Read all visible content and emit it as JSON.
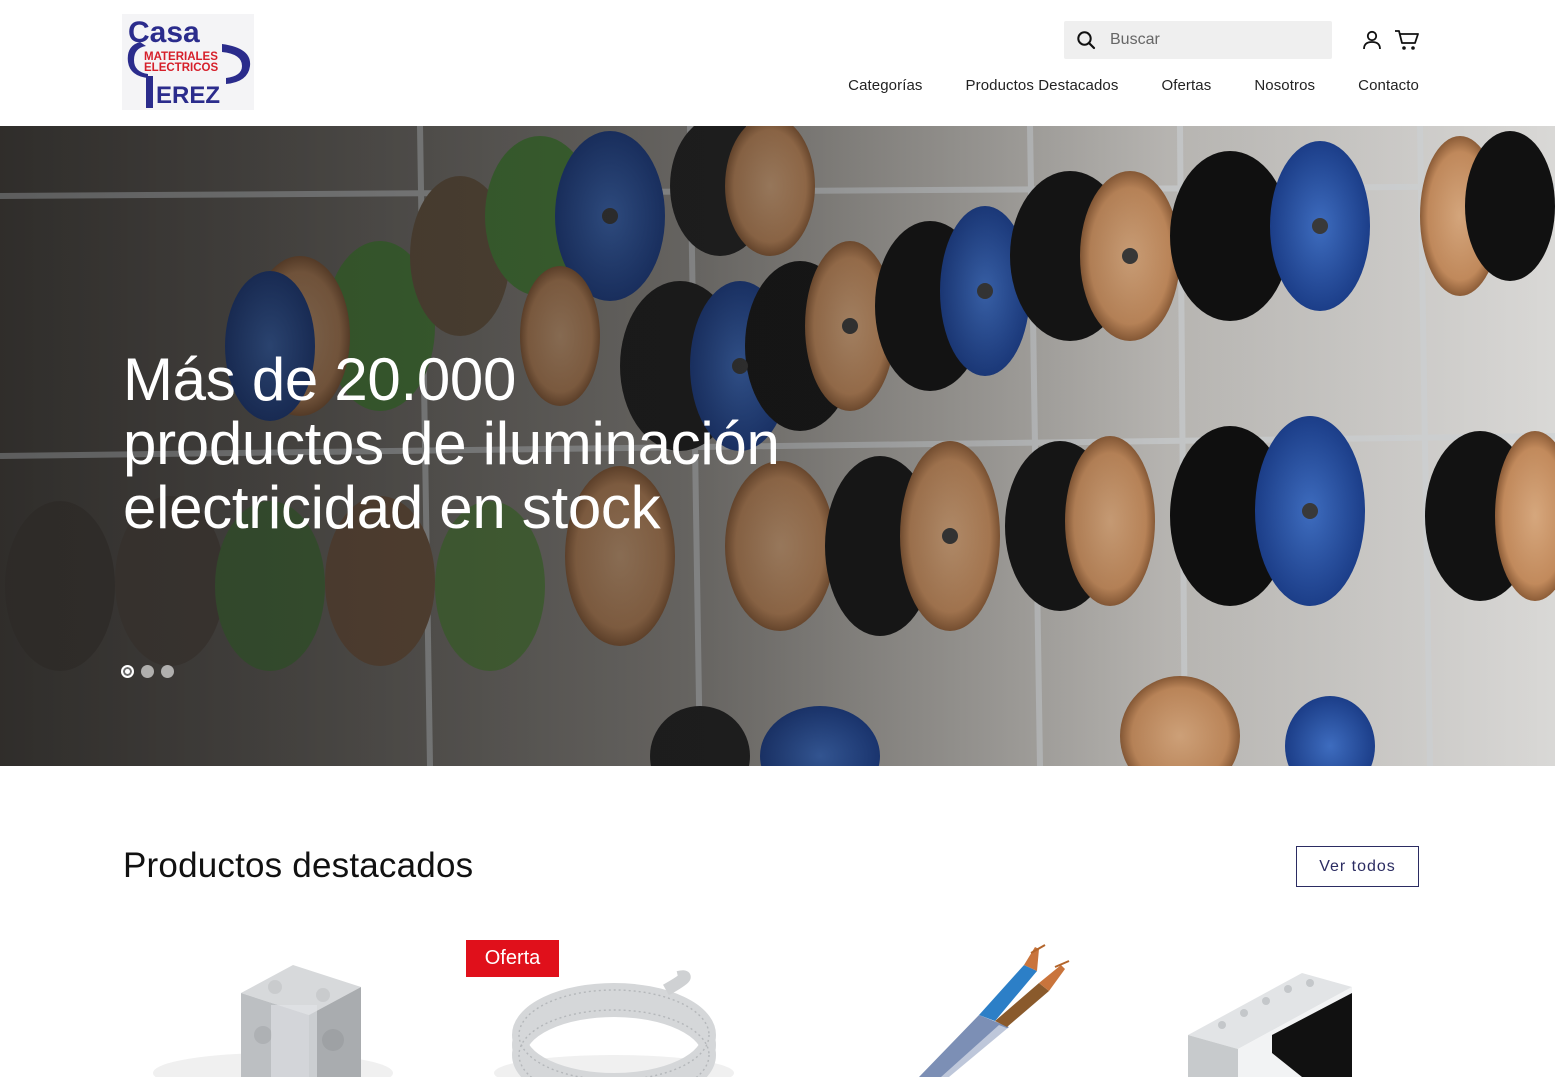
{
  "brand": {
    "logo_word_top": "Casa",
    "logo_line1": "MATERIALES",
    "logo_line2": "ELECTRICOS",
    "logo_word_bottom": "EREZ",
    "colors": {
      "navy": "#2b2c8c",
      "red": "#d61f2a"
    }
  },
  "header": {
    "search_placeholder": "Buscar",
    "icons": [
      "search-icon",
      "user-icon",
      "cart-icon"
    ],
    "nav": [
      "Categorías",
      "Productos Destacados",
      "Ofertas",
      "Nosotros",
      "Contacto"
    ]
  },
  "hero": {
    "title_line1": "Más de 20.000",
    "title_line2": "productos de iluminación",
    "title_line3": "electricidad en stock",
    "slides_total": 3,
    "active_slide": 1
  },
  "featured": {
    "title": "Productos destacados",
    "view_all": "Ver todos",
    "badge": "Oferta",
    "accent_color": "#2b2c62",
    "badge_color": "#e0101b"
  }
}
